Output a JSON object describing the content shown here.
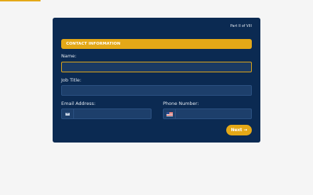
{
  "form": {
    "part_indicator": "Part II of VIII",
    "section_title": "CONTACT INFORMATION",
    "fields": {
      "name": {
        "label": "Name:",
        "value": "",
        "placeholder": ""
      },
      "job_title": {
        "label": "Job Title:",
        "value": "",
        "placeholder": ""
      },
      "email": {
        "label": "Email Address:",
        "value": "",
        "placeholder": "",
        "icon": "envelope-icon"
      },
      "phone": {
        "label": "Phone Number:",
        "value": "",
        "placeholder": "",
        "icon": "us-flag-icon"
      }
    },
    "next_label": "Next",
    "next_arrow": "→"
  },
  "progress": {
    "fraction": 0.13
  },
  "colors": {
    "card_background": "#0b2a52",
    "accent": "#e4a817",
    "page_background": "#f5f5f5",
    "field_background": "#1d3f6b"
  }
}
